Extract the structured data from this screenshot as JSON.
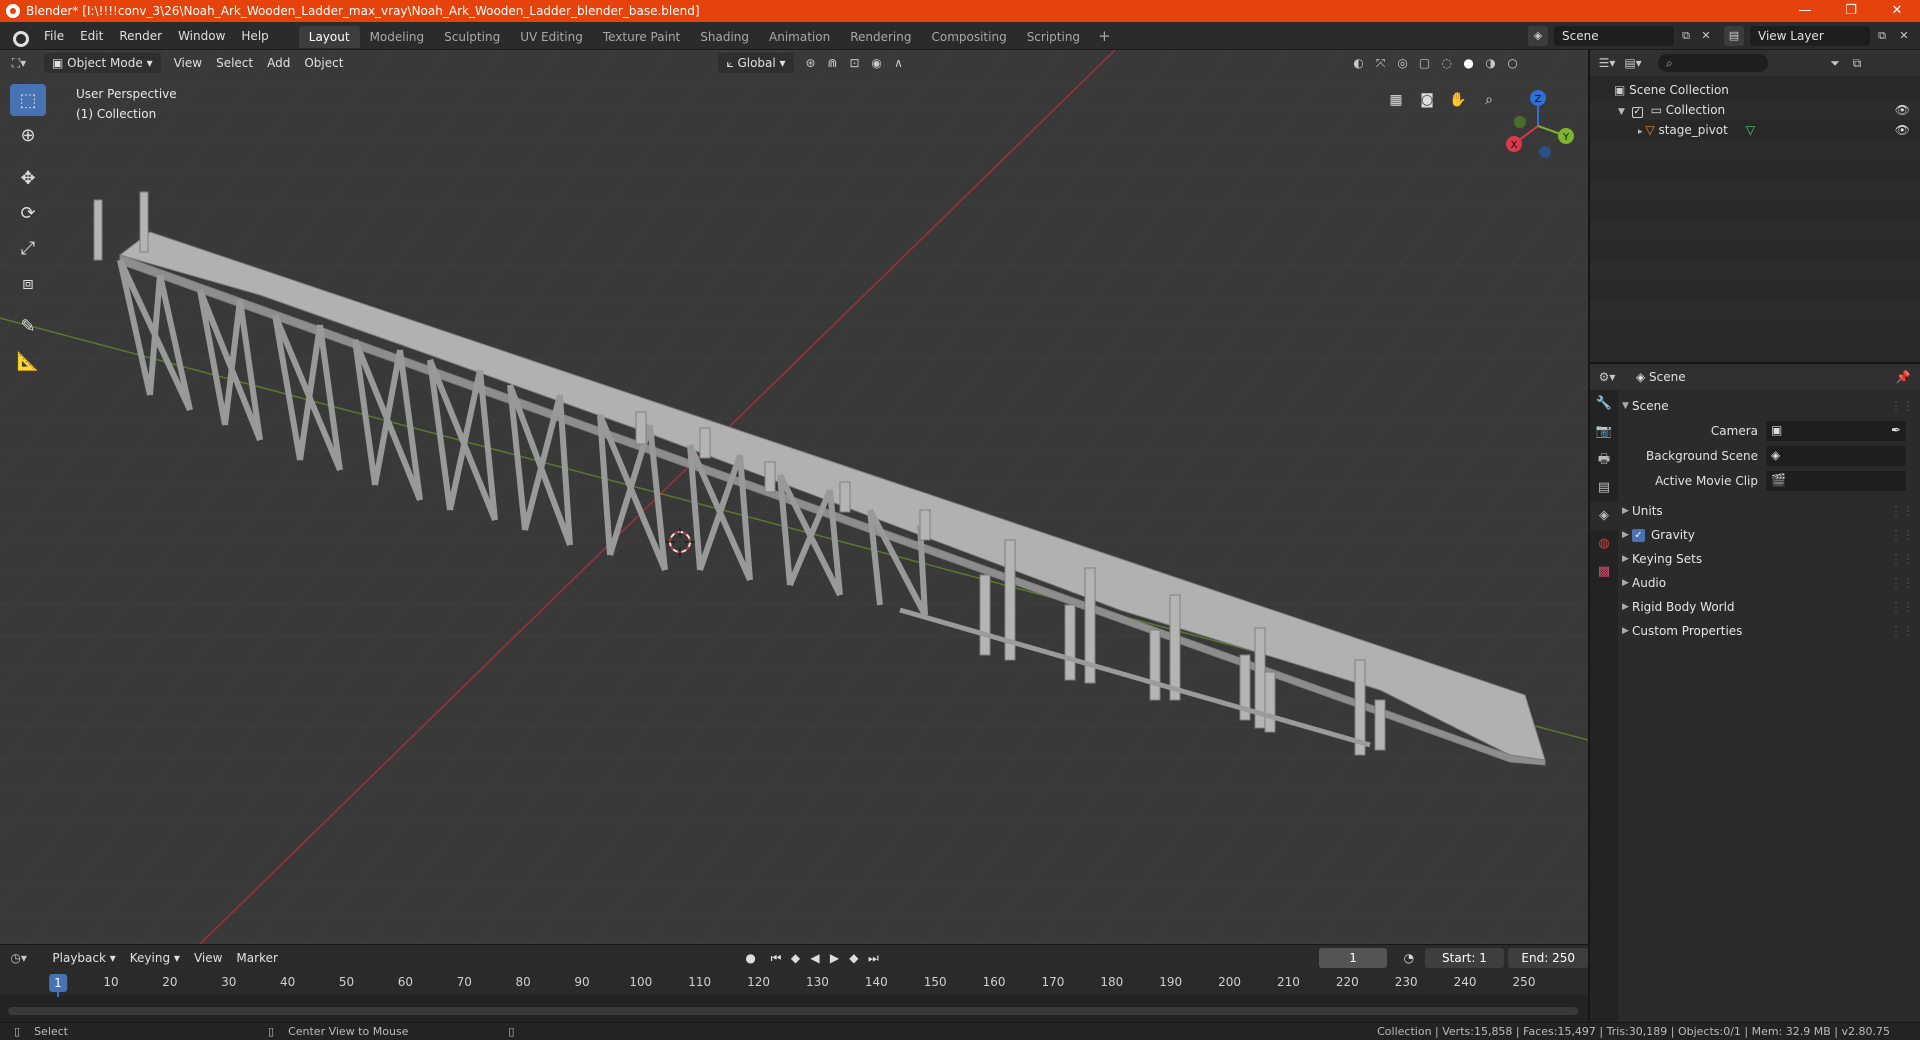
{
  "window": {
    "title": "Blender* [I:\\!!!!conv_3\\26\\Noah_Ark_Wooden_Ladder_max_vray\\Noah_Ark_Wooden_Ladder_blender_base.blend]",
    "minimize": "—",
    "maximize": "❐",
    "close": "✕"
  },
  "menu": [
    "File",
    "Edit",
    "Render",
    "Window",
    "Help"
  ],
  "workspaces": [
    "Layout",
    "Modeling",
    "Sculpting",
    "UV Editing",
    "Texture Paint",
    "Shading",
    "Animation",
    "Rendering",
    "Compositing",
    "Scripting"
  ],
  "workspace_add": "+",
  "scene_name": "Scene",
  "view_layer_name": "View Layer",
  "viewport_header": {
    "mode": "Object Mode",
    "view": "View",
    "select": "Select",
    "add": "Add",
    "object": "Object",
    "orientation": "Global"
  },
  "viewport_info": {
    "perspective": "User Perspective",
    "collection": "(1) Collection"
  },
  "gizmo": {
    "x": "X",
    "y": "Y",
    "z": "Z"
  },
  "timeline": {
    "playback": "Playback",
    "keying": "Keying",
    "view": "View",
    "marker": "Marker",
    "current_frame": "1",
    "start_label": "Start:",
    "start": "1",
    "end_label": "End:",
    "end": "250",
    "ticks": [
      "1",
      "10",
      "20",
      "30",
      "40",
      "50",
      "60",
      "70",
      "80",
      "90",
      "100",
      "110",
      "120",
      "130",
      "140",
      "150",
      "160",
      "170",
      "180",
      "190",
      "200",
      "210",
      "220",
      "230",
      "240",
      "250"
    ]
  },
  "status": {
    "left_action": "Select",
    "middle_action": "Center View to Mouse",
    "stats": "Collection | Verts:15,858 | Faces:15,497 | Tris:30,189 | Objects:0/1 | Mem: 32.9 MB | v2.80.75"
  },
  "outliner": {
    "root": "Scene Collection",
    "collection": "Collection",
    "object": "stage_pivot"
  },
  "properties": {
    "context": "Scene",
    "panel_scene": "Scene",
    "camera_label": "Camera",
    "background_scene_label": "Background Scene",
    "active_movie_clip_label": "Active Movie Clip",
    "panels": [
      "Units",
      "Gravity",
      "Keying Sets",
      "Audio",
      "Rigid Body World",
      "Custom Properties"
    ]
  },
  "colors": {
    "titlebar": "#e6420b",
    "accent": "#4772b3",
    "viewport_bg": "#393939",
    "x_axis": "#c8394a",
    "y_axis": "#7aa13a"
  }
}
